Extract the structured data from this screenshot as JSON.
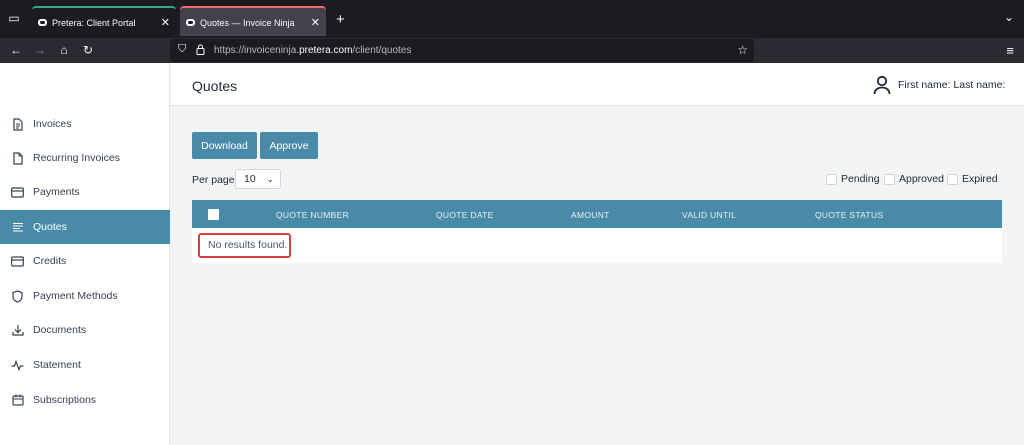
{
  "browser": {
    "tabs": [
      {
        "title": "Pretera: Client Portal",
        "active": false
      },
      {
        "title": "Quotes — Invoice Ninja",
        "active": true
      }
    ],
    "url": {
      "prefix": "https://invoiceninja.",
      "host": "pretera.com",
      "path": "/client/quotes"
    }
  },
  "header": {
    "title": "Quotes",
    "user_name": "First name: Last name:"
  },
  "sidebar": {
    "items": [
      {
        "label": "Invoices",
        "icon": "document-icon",
        "active": false
      },
      {
        "label": "Recurring Invoices",
        "icon": "file-icon",
        "active": false
      },
      {
        "label": "Payments",
        "icon": "credit-card-icon",
        "active": false
      },
      {
        "label": "Quotes",
        "icon": "list-lines-icon",
        "active": true
      },
      {
        "label": "Credits",
        "icon": "credit-card-icon",
        "active": false
      },
      {
        "label": "Payment Methods",
        "icon": "shield-icon",
        "active": false
      },
      {
        "label": "Documents",
        "icon": "download-icon",
        "active": false
      },
      {
        "label": "Statement",
        "icon": "activity-icon",
        "active": false
      },
      {
        "label": "Subscriptions",
        "icon": "calendar-icon",
        "active": false
      }
    ]
  },
  "toolbar": {
    "download_label": "Download",
    "approve_label": "Approve"
  },
  "per_page": {
    "label": "Per page",
    "value": "10"
  },
  "filters": [
    {
      "label": "Pending",
      "checked": false
    },
    {
      "label": "Approved",
      "checked": false
    },
    {
      "label": "Expired",
      "checked": false
    }
  ],
  "table": {
    "columns": [
      "QUOTE NUMBER",
      "QUOTE DATE",
      "AMOUNT",
      "VALID UNTIL",
      "QUOTE STATUS"
    ],
    "empty_message": "No results found."
  },
  "colors": {
    "accent": "#4a8aa9",
    "highlight": "#d9403f"
  }
}
